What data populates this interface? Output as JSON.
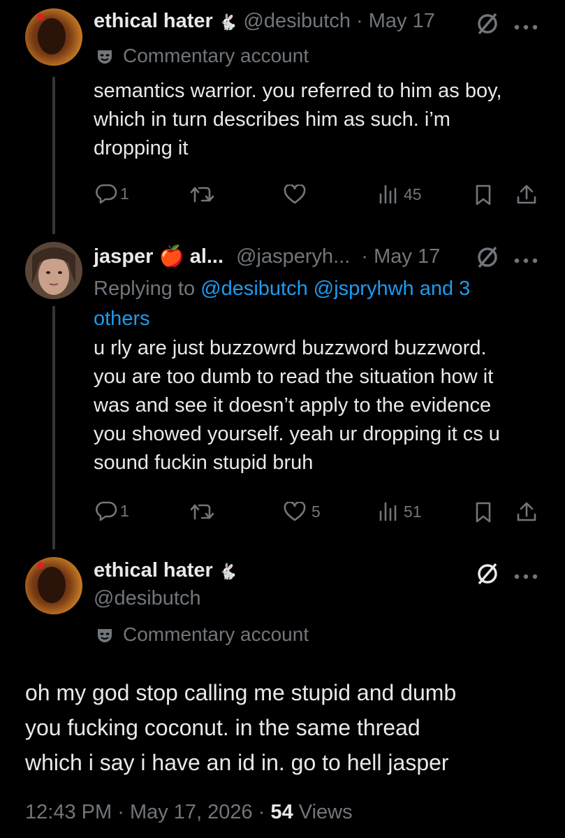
{
  "tweets": [
    {
      "display_name": "ethical hater",
      "name_emoji": "🐇",
      "handle": "@desibutch",
      "date_sep": "·",
      "date": "May 17",
      "badge": "Commentary account",
      "text_lines": [
        "semantics warrior. you referred to him as boy,",
        "which in turn describes him as such. i’m",
        "dropping it"
      ],
      "replies": "1",
      "retweets": "",
      "likes": "",
      "views": "45"
    },
    {
      "display_name": "jasper",
      "name_emoji": "🍎",
      "name_suffix": "al...",
      "handle": "@jasperyh...",
      "date_sep": "·",
      "date": "May 17",
      "replying_prefix": "Replying to",
      "replying_to": "@desibutch @jspryhwh and 3",
      "replying_to_2": "others",
      "text_lines": [
        "u rly are just buzzowrd buzzword buzzword.",
        "you are too dumb to read the situation how it",
        "was and see it doesn’t apply to the evidence",
        "you showed yourself. yeah ur dropping it cs u",
        "sound fuckin stupid bruh"
      ],
      "replies": "1",
      "retweets": "",
      "likes": "5",
      "views": "51"
    }
  ],
  "main_tweet": {
    "display_name": "ethical hater",
    "name_emoji": "🐇",
    "handle": "@desibutch",
    "badge": "Commentary account",
    "text_lines": [
      "oh my god stop calling me stupid and dumb",
      "you fucking coconut. in the same thread",
      "which i say i have an id in. go to hell jasper"
    ],
    "time": "12:43 PM",
    "sep1": "·",
    "date": "May 17, 2026",
    "sep2": "·",
    "views_count": "54",
    "views_label": "Views"
  },
  "icons": [
    "avatar",
    "no-sign-icon",
    "more-icon",
    "mask-icon",
    "reply-icon",
    "retweet-icon",
    "like-icon",
    "views-icon",
    "bookmark-icon",
    "share-icon"
  ]
}
